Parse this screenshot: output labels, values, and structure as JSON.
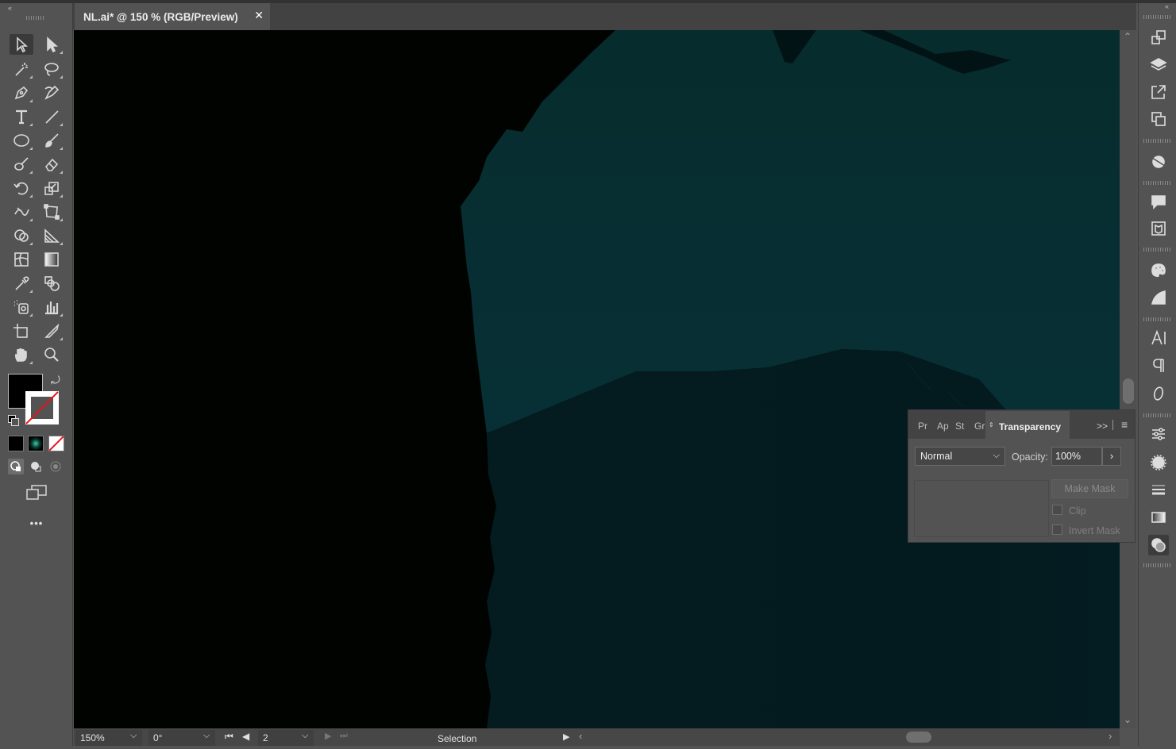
{
  "document": {
    "tab_title": "NL.ai* @ 150 % (RGB/Preview)",
    "close_glyph": "✕"
  },
  "toolbar": {
    "tools": [
      {
        "id": "selection-tool"
      },
      {
        "id": "direct-selection-tool"
      },
      {
        "id": "magic-wand-tool"
      },
      {
        "id": "lasso-tool"
      },
      {
        "id": "pen-tool"
      },
      {
        "id": "curvature-tool"
      },
      {
        "id": "type-tool"
      },
      {
        "id": "line-segment-tool"
      },
      {
        "id": "ellipse-tool"
      },
      {
        "id": "paintbrush-tool"
      },
      {
        "id": "blob-brush-tool"
      },
      {
        "id": "eraser-tool"
      },
      {
        "id": "rotate-tool"
      },
      {
        "id": "scale-tool"
      },
      {
        "id": "width-tool"
      },
      {
        "id": "free-transform-tool"
      },
      {
        "id": "shape-builder-tool"
      },
      {
        "id": "perspective-grid-tool"
      },
      {
        "id": "mesh-tool"
      },
      {
        "id": "gradient-tool"
      },
      {
        "id": "eyedropper-tool"
      },
      {
        "id": "blend-tool"
      },
      {
        "id": "symbol-sprayer-tool"
      },
      {
        "id": "column-graph-tool"
      },
      {
        "id": "artboard-tool"
      },
      {
        "id": "slice-tool"
      },
      {
        "id": "hand-tool"
      },
      {
        "id": "zoom-tool"
      }
    ],
    "fill_color": "#000000",
    "stroke": "none",
    "color_modes": [
      "color",
      "gradient",
      "none"
    ],
    "more_tools": "•••"
  },
  "canvas": {
    "background": "#000300",
    "shape_colors": [
      "#062a2c",
      "#031d21",
      "#041416"
    ]
  },
  "status": {
    "zoom": "150%",
    "rotation": "0°",
    "artboard": "2",
    "tool_name": "Selection"
  },
  "transparency_panel": {
    "tabs": [
      "Pr",
      "Ap",
      "St",
      "Gr"
    ],
    "active_tab": "Transparency",
    "expand_glyph": ">>",
    "blend_mode": "Normal",
    "opacity_label": "Opacity:",
    "opacity_value": "100%",
    "make_mask_label": "Make Mask",
    "clip_label": "Clip",
    "invert_mask_label": "Invert Mask"
  },
  "dock": {
    "icons": [
      "artboards-icon",
      "layers-icon",
      "export-icon",
      "arrange-icon",
      "libraries-icon",
      "comments-icon",
      "document-info-icon",
      "color-themes-icon",
      "color-guide-icon",
      "character-icon",
      "paragraph-icon",
      "opentype-icon",
      "properties-icon",
      "appearance-icon",
      "stroke-icon",
      "gradient-icon",
      "transparency-icon"
    ]
  }
}
